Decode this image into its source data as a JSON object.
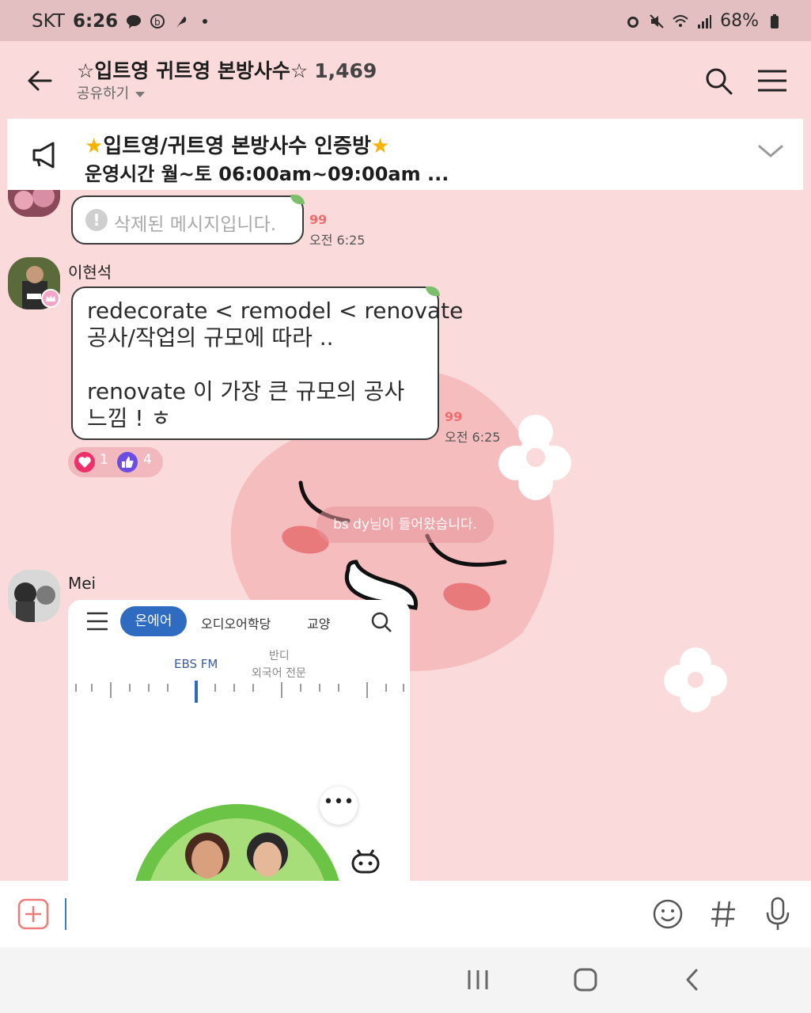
{
  "status": {
    "carrier": "SKT",
    "time": "6:26",
    "battery": "68%",
    "icons": [
      "talk-icon",
      "b-icon",
      "feather-icon",
      "dot-icon",
      "alarm-icon",
      "mute-icon",
      "wifi-icon",
      "signal-icon",
      "battery-icon"
    ]
  },
  "header": {
    "title": "☆입트영 귀트영 본방사수☆",
    "member_count": "1,469",
    "subtitle": "공유하기"
  },
  "notice": {
    "line1": "입트영/귀트영 본방사수 인증방",
    "line2": "운영시간 월~토 06:00am~09:00am ..."
  },
  "messages": {
    "deleted": {
      "text": "삭제된 메시지입니다.",
      "unread": "99",
      "time": "오전 6:25"
    },
    "m1": {
      "sender": "이현석",
      "text": "redecorate < remodel < renovate\n공사/작업의 규모에 따라 ..\n\nrenovate 이 가장 큰 규모의 공사\n느낌 ! ㅎ",
      "unread": "99",
      "time": "오전 6:25",
      "reactions": {
        "heart": "1",
        "like": "4"
      }
    },
    "system": "bs dy님이 들어왔습니다.",
    "m2": {
      "sender": "Mei",
      "image": {
        "tab_active": "온에어",
        "tab2": "오디오어학당",
        "tab3": "교양",
        "station": "EBS FM",
        "station2_l1": "반디",
        "station2_l2": "외국어 전문"
      }
    }
  },
  "input": {
    "value": ""
  },
  "colors": {
    "background": "#fadada",
    "statusbar": "#e3bfc1",
    "unread": "#f06d6d",
    "accent": "#2e6bc1"
  }
}
